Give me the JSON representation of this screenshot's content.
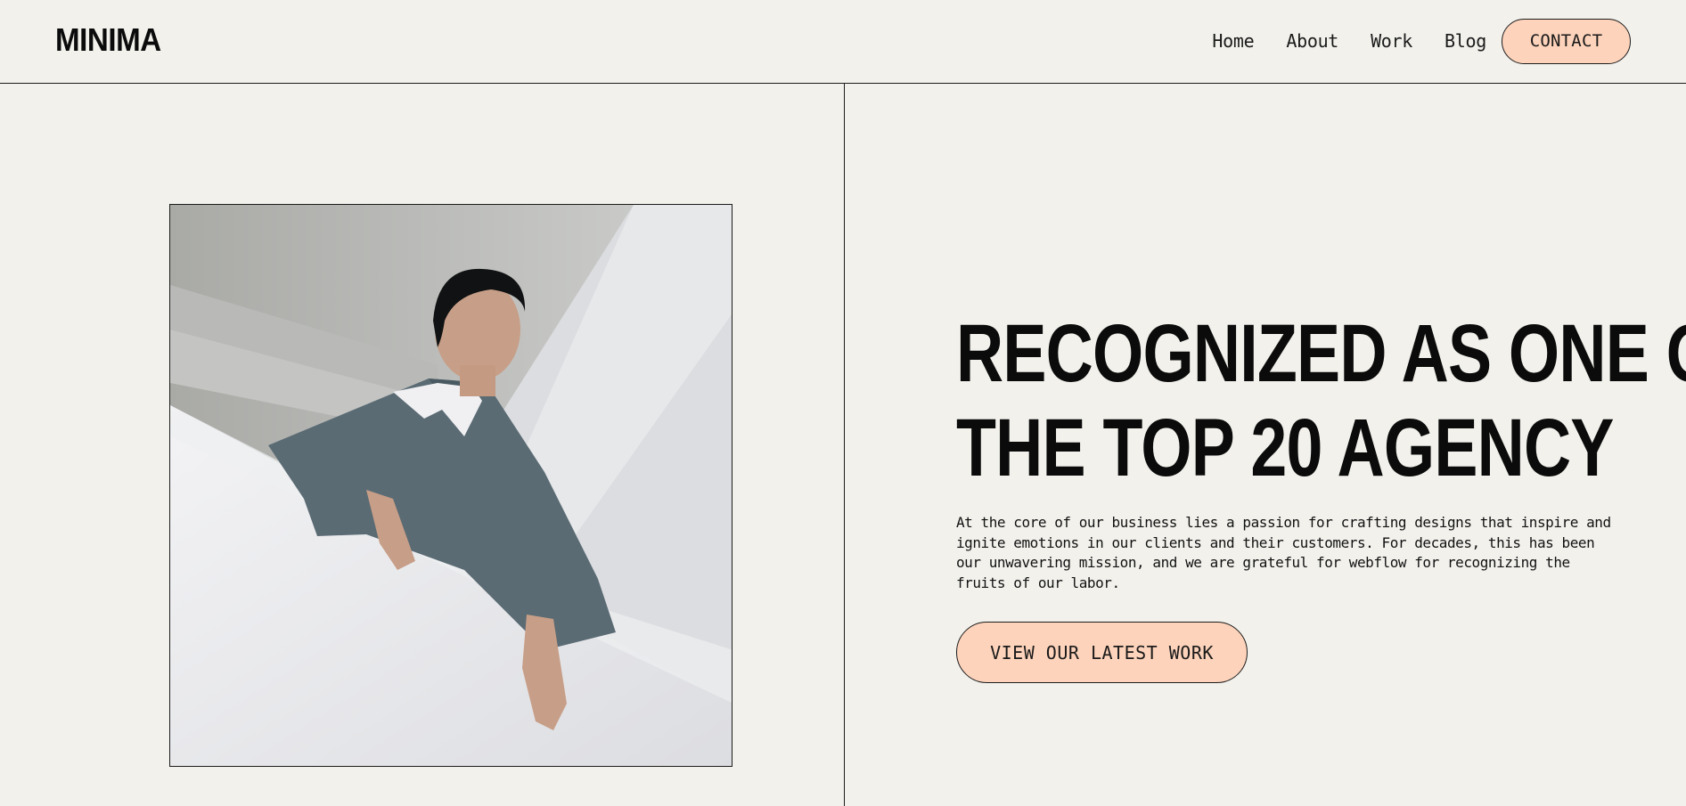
{
  "brand": {
    "logo_text": "MINIMA"
  },
  "nav": {
    "links": [
      {
        "label": "Home"
      },
      {
        "label": "About"
      },
      {
        "label": "Work"
      },
      {
        "label": "Blog"
      }
    ],
    "contact_label": "CONTACT"
  },
  "hero": {
    "image_subject": "man-in-grey-jacket-leaning-over-white-wall",
    "headline_line1": "RECOGNIZED AS ONE OF",
    "headline_line2": "THE TOP 20 AGENCY",
    "body": "At the core of our business lies a passion for crafting designs that inspire and ignite emotions in our clients and their customers. For decades, this has been our unwavering mission, and we are grateful for webflow for recognizing the fruits of our labor.",
    "cta_label": "VIEW OUR LATEST WORK"
  },
  "colors": {
    "background": "#f2f1ec",
    "accent": "#fdd3bb",
    "text": "#0b0b0b",
    "line": "#1c1c1c"
  }
}
